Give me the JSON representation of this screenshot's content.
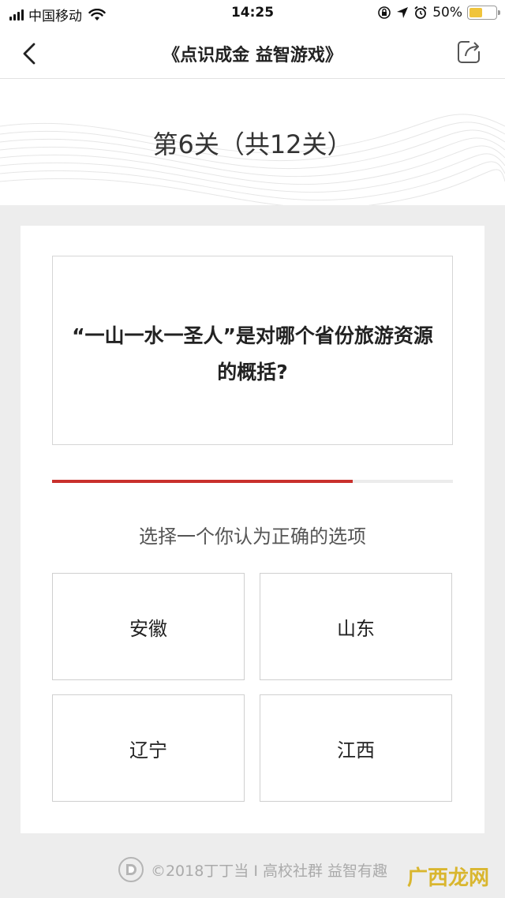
{
  "status_bar": {
    "carrier": "中国移动",
    "time": "14:25",
    "battery_text": "50%",
    "battery_level": 0.5,
    "icons": [
      "signal-icon",
      "wifi-icon",
      "orientation-lock-icon",
      "location-icon",
      "alarm-icon",
      "battery-icon"
    ]
  },
  "nav": {
    "title": "《点识成金 益智游戏》",
    "back_icon": "chevron-left-icon",
    "share_icon": "share-icon"
  },
  "level": {
    "text": "第6关（共12关）"
  },
  "question": {
    "text": "“一山一水一圣人”是对哪个省份旅游资源的概括?"
  },
  "progress": {
    "fraction": 0.75,
    "fill_color": "#c9302c"
  },
  "instruction": "选择一个你认为正确的选项",
  "options": [
    {
      "label": "安徽"
    },
    {
      "label": "山东"
    },
    {
      "label": "辽宁"
    },
    {
      "label": "江西"
    }
  ],
  "footer": {
    "text": "©2018丁丁当 I 高校社群 益智有趣",
    "logo_icon": "dingdingdang-logo-icon"
  },
  "watermark": {
    "text": "广西龙网"
  }
}
